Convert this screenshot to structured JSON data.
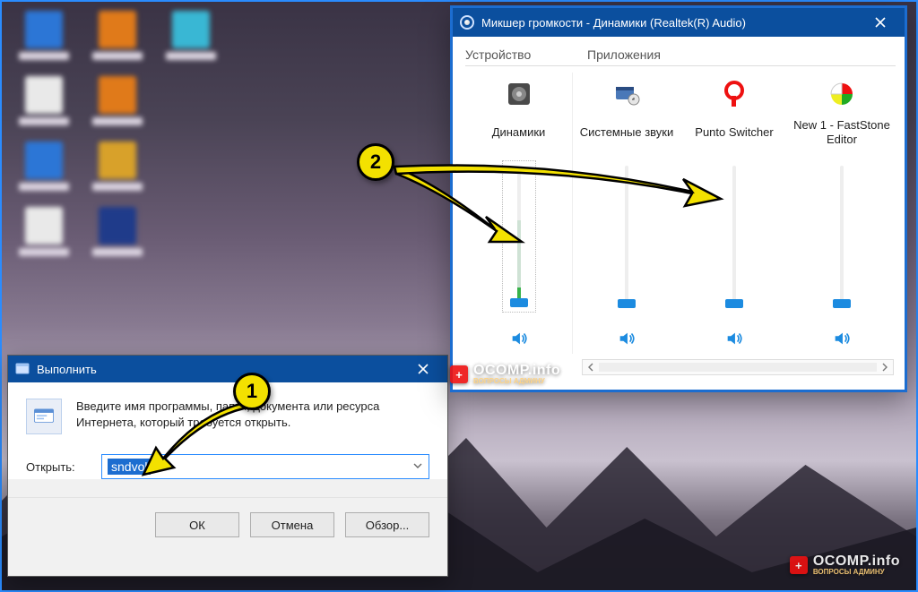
{
  "run": {
    "title": "Выполнить",
    "description": "Введите имя программы, папки, документа или ресурса Интернета, который требуется открыть.",
    "open_label": "Открыть:",
    "input_value": "sndvol",
    "ok_label": "ОК",
    "cancel_label": "Отмена",
    "browse_label": "Обзор..."
  },
  "mixer": {
    "title": "Микшер громкости - Динамики (Realtek(R) Audio)",
    "device_header": "Устройство",
    "apps_header": "Приложения",
    "columns": [
      {
        "name": "Динамики",
        "level_pct": 6,
        "peak_pct": 60,
        "live_pct": 10,
        "is_device": true,
        "icon": "speaker-device"
      },
      {
        "name": "Системные звуки",
        "level_pct": 6,
        "peak_pct": 0,
        "live_pct": 0,
        "is_device": false,
        "icon": "system-sounds"
      },
      {
        "name": "Punto Switcher",
        "level_pct": 6,
        "peak_pct": 0,
        "live_pct": 0,
        "is_device": false,
        "icon": "punto"
      },
      {
        "name": "New 1 - FastStone Editor",
        "level_pct": 6,
        "peak_pct": 0,
        "live_pct": 0,
        "is_device": false,
        "icon": "faststone"
      }
    ]
  },
  "watermark": {
    "line1": "OCOMP.info",
    "line2": "ВОПРОСЫ АДМИНУ"
  },
  "annotations": {
    "badge1": "1",
    "badge2": "2"
  }
}
